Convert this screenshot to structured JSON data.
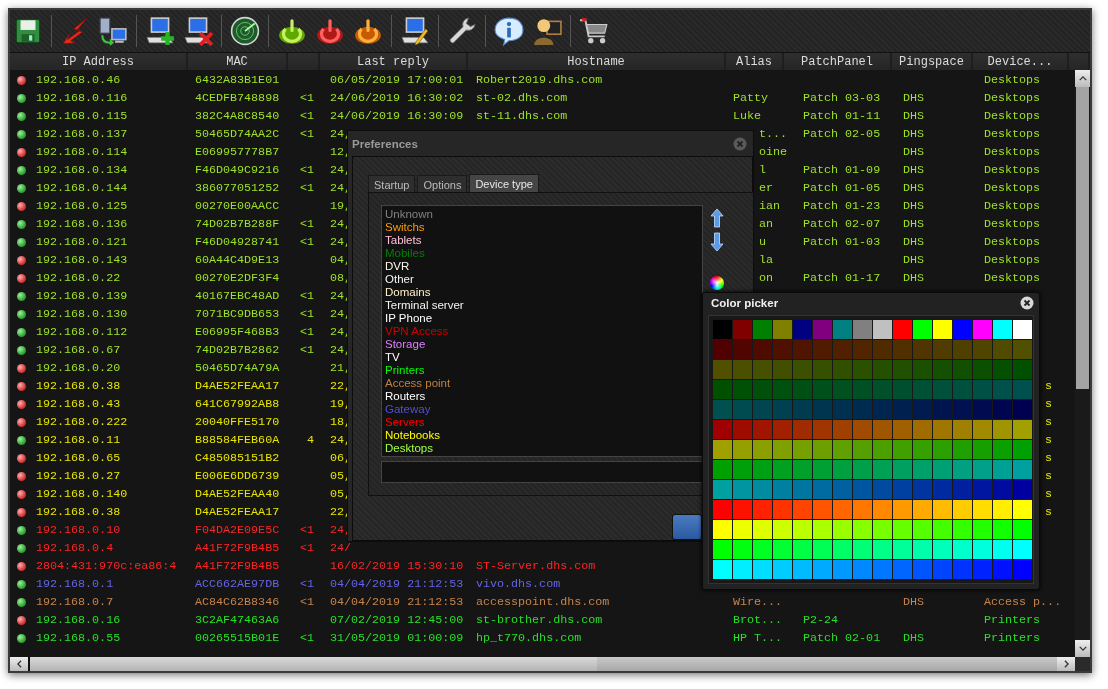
{
  "table": {
    "columns": [
      {
        "label": "IP Address"
      },
      {
        "label": "MAC"
      },
      {},
      {
        "label": "Last reply"
      },
      {
        "label": "Hostname"
      },
      {
        "label": "Alias"
      },
      {
        "label": "PatchPanel"
      },
      {
        "label": "Pingspace"
      },
      {
        "label": "Device..."
      }
    ],
    "rows": [
      {
        "online": false,
        "color": "#9ee22a",
        "cells": [
          "192.168.0.46",
          "6432A83B1E01",
          null,
          "06/05/2019 17:00:01",
          "Robert2019.dhs.com",
          null,
          null,
          null,
          "Desktops"
        ]
      },
      {
        "online": true,
        "color": "#9ee22a",
        "cells": [
          "192.168.0.116",
          "4CEDFB748898",
          "<1",
          "24/06/2019 16:30:02",
          "st-02.dhs.com",
          "Patty",
          "Patch 03-03",
          "DHS",
          "Desktops"
        ]
      },
      {
        "online": true,
        "color": "#9ee22a",
        "cells": [
          "192.168.0.115",
          "382C4A8C8540",
          "<1",
          "24/06/2019 16:30:09",
          "st-11.dhs.com",
          "Luke",
          "Patch 01-11",
          "DHS",
          "Desktops"
        ]
      },
      {
        "online": true,
        "color": "#9ee22a",
        "cells": [
          "192.168.0.137",
          "50465D74AA2C",
          "<1",
          "24,",
          null,
          {
            "text": "t...",
            "cut": true
          },
          "Patch 02-05",
          "DHS",
          "Desktops"
        ]
      },
      {
        "online": false,
        "color": "#9ee22a",
        "cells": [
          "192.168.0.114",
          "E069957778B7",
          null,
          "12,",
          null,
          {
            "text": "oine",
            "cut": true
          },
          null,
          "DHS",
          "Desktops"
        ]
      },
      {
        "online": true,
        "color": "#9ee22a",
        "cells": [
          "192.168.0.134",
          "F46D049C9216",
          "<1",
          "24,",
          null,
          {
            "text": "l",
            "cut": true
          },
          "Patch 01-09",
          "DHS",
          "Desktops"
        ]
      },
      {
        "online": true,
        "color": "#9ee22a",
        "cells": [
          "192.168.0.144",
          "386077051252",
          "<1",
          "24,",
          null,
          {
            "text": "er",
            "cut": true
          },
          "Patch 01-05",
          "DHS",
          "Desktops"
        ]
      },
      {
        "online": false,
        "color": "#9ee22a",
        "cells": [
          "192.168.0.125",
          "00270E00AACC",
          null,
          "19,",
          null,
          {
            "text": "ian",
            "cut": true
          },
          "Patch 01-23",
          "DHS",
          "Desktops"
        ]
      },
      {
        "online": true,
        "color": "#9ee22a",
        "cells": [
          "192.168.0.136",
          "74D02B7B288F",
          "<1",
          "24,",
          null,
          {
            "text": "an",
            "cut": true
          },
          "Patch 02-07",
          "DHS",
          "Desktops"
        ]
      },
      {
        "online": true,
        "color": "#9ee22a",
        "cells": [
          "192.168.0.121",
          "F46D04928741",
          "<1",
          "24,",
          null,
          {
            "text": "u",
            "cut": true
          },
          "Patch 01-03",
          "DHS",
          "Desktops"
        ]
      },
      {
        "online": false,
        "color": "#9ee22a",
        "cells": [
          "192.168.0.143",
          "60A44C4D9E13",
          null,
          "04,",
          null,
          {
            "text": "la",
            "cut": true
          },
          null,
          "DHS",
          "Desktops"
        ]
      },
      {
        "online": false,
        "color": "#9ee22a",
        "cells": [
          "192.168.0.22",
          "00270E2DF3F4",
          null,
          "08,",
          null,
          {
            "text": "on",
            "cut": true
          },
          "Patch 01-17",
          "DHS",
          "Desktops"
        ]
      },
      {
        "online": true,
        "color": "#9ee22a",
        "cells": [
          "192.168.0.139",
          "40167EBC48AD",
          "<1",
          "24,"
        ]
      },
      {
        "online": true,
        "color": "#9ee22a",
        "cells": [
          "192.168.0.130",
          "7071BC9DB653",
          "<1",
          "24,"
        ]
      },
      {
        "online": true,
        "color": "#9ee22a",
        "cells": [
          "192.168.0.112",
          "E06995F468B3",
          "<1",
          "24,"
        ]
      },
      {
        "online": true,
        "color": "#9ee22a",
        "cells": [
          "192.168.0.67",
          "74D02B7B2862",
          "<1",
          "24,"
        ]
      },
      {
        "online": false,
        "color": "#9ee22a",
        "cells": [
          "192.168.0.20",
          "50465D74A79A",
          null,
          "21,"
        ]
      },
      {
        "online": false,
        "color": "#e6e600",
        "cells": [
          "192.168.0.38",
          "D4AE52FEAA17",
          null,
          "22,",
          null,
          null,
          null,
          null,
          {
            "text": "s",
            "cut": true
          }
        ]
      },
      {
        "online": false,
        "color": "#e6e600",
        "cells": [
          "192.168.0.43",
          "641C67992AB8",
          null,
          "19,",
          null,
          null,
          null,
          null,
          {
            "text": "s",
            "cut": true
          }
        ]
      },
      {
        "online": false,
        "color": "#e6e600",
        "cells": [
          "192.168.0.222",
          "20040FFE5170",
          null,
          "18,",
          null,
          null,
          null,
          null,
          {
            "text": "s",
            "cut": true
          }
        ]
      },
      {
        "online": true,
        "color": "#e6e600",
        "cells": [
          "192.168.0.11",
          "B88584FEB60A",
          "4",
          "24,",
          null,
          null,
          null,
          null,
          {
            "text": "s",
            "cut": true
          }
        ]
      },
      {
        "online": false,
        "color": "#e6e600",
        "cells": [
          "192.168.0.65",
          "C485085151B2",
          null,
          "06,",
          null,
          null,
          null,
          null,
          {
            "text": "s",
            "cut": true
          }
        ]
      },
      {
        "online": false,
        "color": "#e6e600",
        "cells": [
          "192.168.0.27",
          "E006E6DD6739",
          null,
          "05,",
          null,
          null,
          null,
          null,
          {
            "text": "s",
            "cut": true
          }
        ]
      },
      {
        "online": false,
        "color": "#e6e600",
        "cells": [
          "192.168.0.140",
          "D4AE52FEAA40",
          null,
          "05,",
          null,
          null,
          null,
          null,
          {
            "text": "s",
            "cut": true
          }
        ]
      },
      {
        "online": false,
        "color": "#e6e600",
        "cells": [
          "192.168.0.38",
          "D4AE52FEAA17",
          null,
          "22,",
          null,
          null,
          null,
          null,
          {
            "text": "s",
            "cut": true
          }
        ]
      },
      {
        "online": true,
        "color": "#ff2424",
        "cells": [
          "192.168.0.10",
          "F04DA2E09E5C",
          "<1",
          "24,"
        ]
      },
      {
        "online": true,
        "color": "#ff2424",
        "cells": [
          "192.168.0.4",
          "A41F72F9B4B5",
          "<1",
          "24/"
        ]
      },
      {
        "online": false,
        "color": "#ff2424",
        "cells": [
          "2804:431:970c:ea86:4",
          "A41F72F9B4B5",
          null,
          "16/02/2019 15:30:10",
          "ST-Server.dhs.com"
        ]
      },
      {
        "online": true,
        "color": "#6464e6",
        "cells": [
          "192.168.0.1",
          "ACC662AE97DB",
          "<1",
          "04/04/2019 21:12:53",
          "vivo.dhs.com"
        ]
      },
      {
        "online": true,
        "color": "#c8844a",
        "cells": [
          "192.168.0.7",
          "AC84C62B8346",
          "<1",
          "04/04/2019 21:12:53",
          "accesspoint.dhs.com",
          "Wire...",
          null,
          "DHS",
          "Access p..."
        ]
      },
      {
        "online": false,
        "color": "#28e028",
        "cells": [
          "192.168.0.16",
          "3C2AF47463A6",
          null,
          "07/02/2019 12:45:00",
          "st-brother.dhs.com",
          "Brot...",
          "P2-24",
          null,
          "Printers"
        ]
      },
      {
        "online": true,
        "color": "#28e028",
        "cells": [
          "192.168.0.55",
          "00265515B01E",
          "<1",
          "31/05/2019 01:00:09",
          "hp_t770.dhs.com",
          "HP T...",
          "Patch 02-01",
          "DHS",
          "Printers"
        ]
      }
    ]
  },
  "preferences": {
    "title": "Preferences",
    "tabs": [
      {
        "label": "Startup",
        "selected": false
      },
      {
        "label": "Options",
        "selected": false
      },
      {
        "label": "Device type",
        "selected": true
      }
    ],
    "device_types": [
      {
        "label": "Unknown",
        "color": "#808080"
      },
      {
        "label": "Switchs",
        "color": "#ff9900"
      },
      {
        "label": "Tablets",
        "color": "#ffc0d8"
      },
      {
        "label": "Mobiles",
        "color": "#008000"
      },
      {
        "label": "DVR",
        "color": "#fff8e8"
      },
      {
        "label": "Other",
        "color": "#f5f5f5"
      },
      {
        "label": "Domains",
        "color": "#fff0c8"
      },
      {
        "label": "Terminal server",
        "color": "#f5f5f5"
      },
      {
        "label": "IP Phone",
        "color": "#ffffff"
      },
      {
        "label": "VPN Access",
        "color": "#d00000"
      },
      {
        "label": "Storage",
        "color": "#e080ff"
      },
      {
        "label": "TV",
        "color": "#ffffff"
      },
      {
        "label": "Printers",
        "color": "#00ff00"
      },
      {
        "label": "Access point",
        "color": "#c08040"
      },
      {
        "label": "Routers",
        "color": "#ffffff"
      },
      {
        "label": "Gateway",
        "color": "#5050d0"
      },
      {
        "label": "Servers",
        "color": "#ff0000"
      },
      {
        "label": "Notebooks",
        "color": "#ffff00"
      },
      {
        "label": "Desktops",
        "color": "#a0ff40"
      }
    ]
  },
  "color_picker": {
    "title": "Color picker",
    "basic_colors": [
      {
        "color": "#000000"
      },
      {
        "color": "#800000"
      },
      {
        "color": "#008000"
      },
      {
        "color": "#808000"
      },
      {
        "color": "#000080"
      },
      {
        "color": "#800080"
      },
      {
        "color": "#008080"
      },
      {
        "color": "#808080"
      },
      {
        "color": "#c0c0c0"
      },
      {
        "color": "#ff0000"
      },
      {
        "color": "#00ff00"
      },
      {
        "color": "#ffff00"
      },
      {
        "color": "#0000ff"
      },
      {
        "color": "#ff00ff"
      },
      {
        "color": "#00ffff"
      },
      {
        "color": "#ffffff"
      }
    ]
  }
}
